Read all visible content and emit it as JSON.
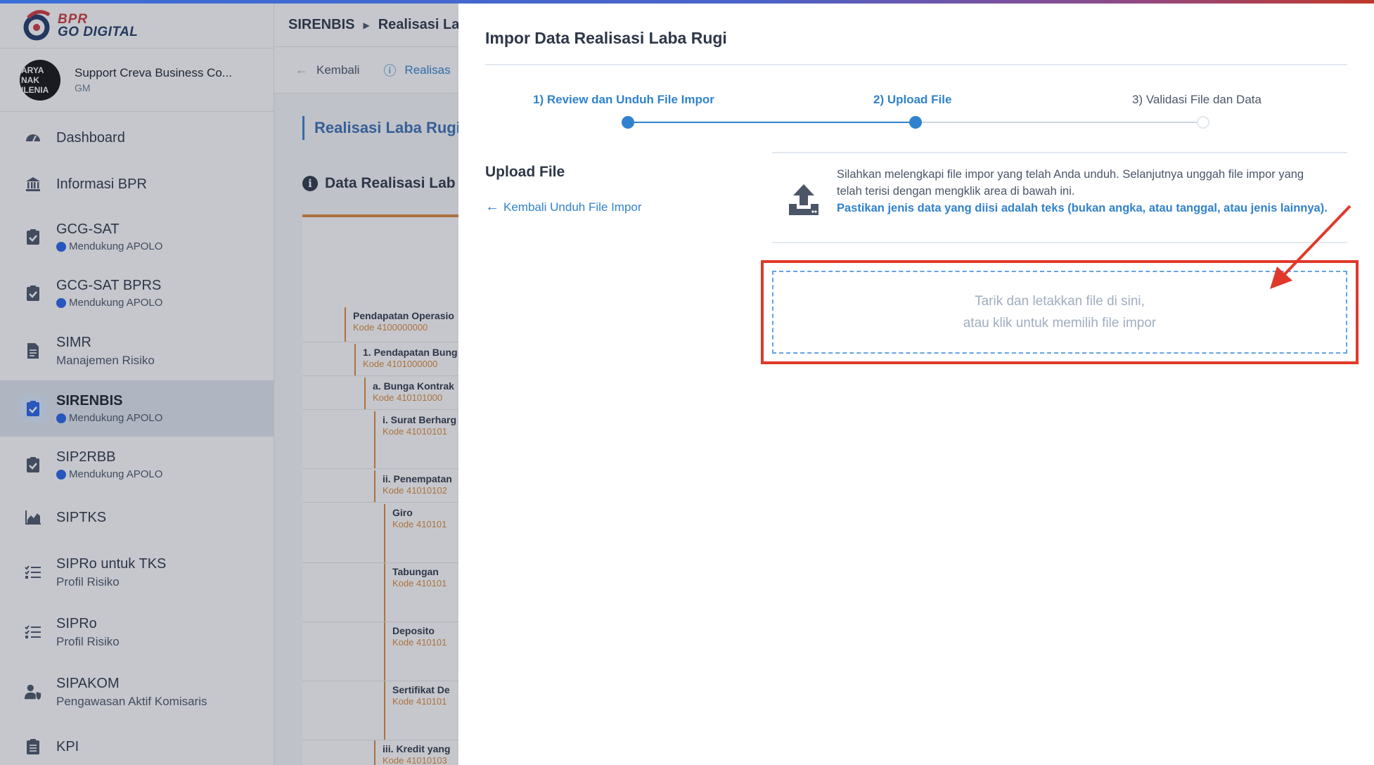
{
  "brand": {
    "line1": "BPR",
    "line2": "GO DIGITAL"
  },
  "profile": {
    "avatar_text": [
      "ARYA",
      "NAK",
      "ILENIA"
    ],
    "name": "Support Creva Business Co...",
    "role": "GM"
  },
  "sidebar": {
    "items": [
      {
        "label": "Dashboard",
        "sub": "",
        "icon": "gauge-icon"
      },
      {
        "label": "Informasi BPR",
        "sub": "",
        "icon": "bank-icon"
      },
      {
        "label": "GCG-SAT",
        "sub": "Mendukung APOLO",
        "icon": "clipboard-check-icon"
      },
      {
        "label": "GCG-SAT BPRS",
        "sub": "Mendukung APOLO",
        "icon": "clipboard-check-icon"
      },
      {
        "label": "SIMR",
        "sub": "Manajemen Risiko",
        "icon": "document-icon"
      },
      {
        "label": "SIRENBIS",
        "sub": "Mendukung APOLO",
        "icon": "clipboard-check-icon",
        "active": true
      },
      {
        "label": "SIP2RBB",
        "sub": "Mendukung APOLO",
        "icon": "clipboard-check-icon"
      },
      {
        "label": "SIPTKS",
        "sub": "",
        "icon": "area-chart-icon"
      },
      {
        "label": "SIPRo untuk TKS",
        "sub": "Profil Risiko",
        "icon": "checklist-icon"
      },
      {
        "label": "SIPRo",
        "sub": "Profil Risiko",
        "icon": "checklist-icon"
      },
      {
        "label": "SIPAKOM",
        "sub": "Pengawasan Aktif Komisaris",
        "icon": "user-shield-icon"
      },
      {
        "label": "KPI",
        "sub": "",
        "icon": "clipboard-list-icon"
      }
    ]
  },
  "breadcrumb": {
    "root": "SIRENBIS",
    "current": "Realisasi La"
  },
  "tabs": {
    "back": "Kembali",
    "current": "Realisas"
  },
  "main": {
    "page_title": "Realisasi Laba Rugi",
    "section_title": "Data Realisasi Lab"
  },
  "tree_rows": [
    {
      "label": "Pendapatan Operasio",
      "kode": "Kode 4100000000"
    },
    {
      "label": "1. Pendapatan Bung",
      "kode": "Kode 4101000000"
    },
    {
      "label": "a. Bunga Kontrak",
      "kode": "Kode 410101000"
    },
    {
      "label": "i. Surat Berharg",
      "kode": "Kode 41010101"
    },
    {
      "label": "ii. Penempatan",
      "kode": "Kode 41010102"
    },
    {
      "label": "Giro",
      "kode": "Kode 410101"
    },
    {
      "label": "Tabungan",
      "kode": "Kode 410101"
    },
    {
      "label": "Deposito",
      "kode": "Kode 410101"
    },
    {
      "label": "Sertifikat De",
      "kode": "Kode 410101"
    },
    {
      "label": "iii. Kredit yang",
      "kode": "Kode 41010103"
    }
  ],
  "modal": {
    "title": "Impor Data Realisasi Laba Rugi",
    "steps": [
      {
        "label": "1) Review dan Unduh File Impor",
        "state": "done"
      },
      {
        "label": "2) Upload File",
        "state": "active"
      },
      {
        "label": "3) Validasi File dan Data",
        "state": "pending"
      }
    ],
    "upload_heading": "Upload File",
    "back_link": "Kembali Unduh File Impor",
    "info_text": "Silahkan melengkapi file impor yang telah Anda unduh. Selanjutnya unggah file impor yang telah terisi dengan mengklik area di bawah ini.",
    "info_note": "Pastikan jenis data yang diisi adalah teks (bukan angka, atau tanggal, atau jenis lainnya).",
    "dropzone_line1": "Tarik dan letakkan file di sini,",
    "dropzone_line2": "atau klik untuk memilih file impor"
  },
  "colors": {
    "accent": "#3182ce",
    "highlight": "#e0392b",
    "tree_accent": "#dd8a3c"
  }
}
